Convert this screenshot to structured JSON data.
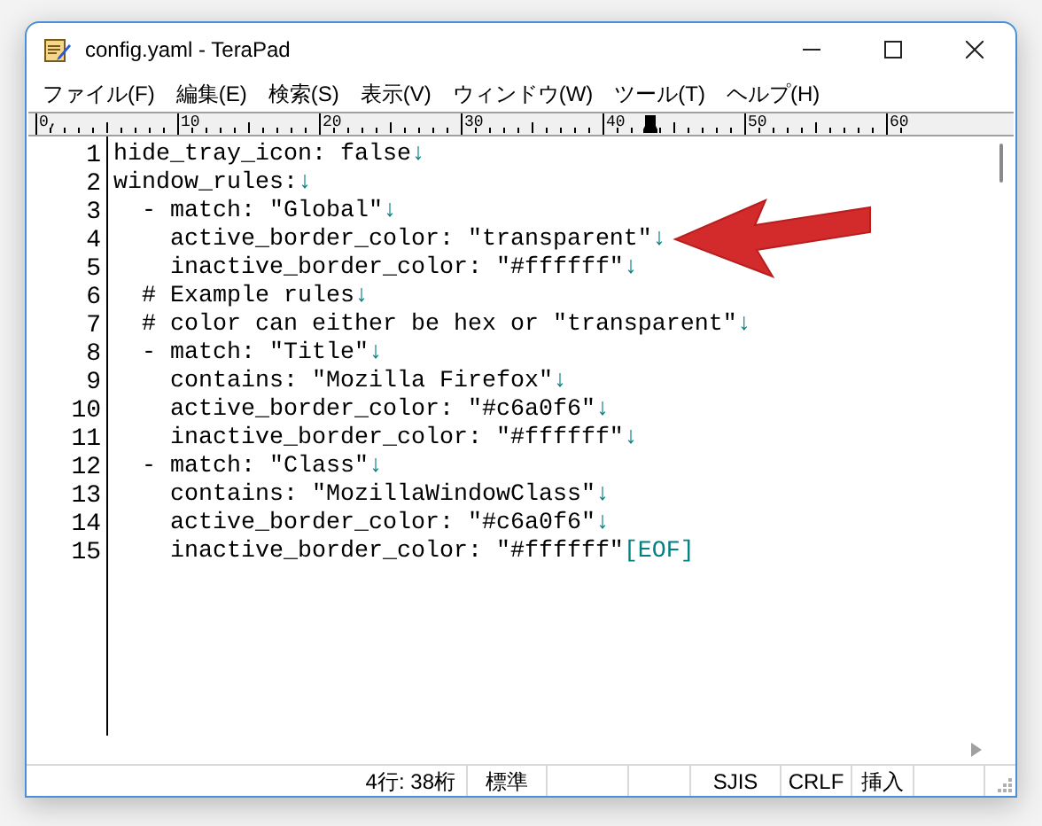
{
  "window": {
    "title": "config.yaml - TeraPad"
  },
  "menu": [
    "ファイル(F)",
    "編集(E)",
    "検索(S)",
    "表示(V)",
    "ウィンドウ(W)",
    "ツール(T)",
    "ヘルプ(H)"
  ],
  "ruler": {
    "labels": [
      "0,",
      "10",
      "20",
      "30",
      "40",
      "50",
      "60"
    ]
  },
  "lines": [
    {
      "number": "1",
      "text": "hide_tray_icon: false",
      "end": "↓"
    },
    {
      "number": "2",
      "text": "window_rules:",
      "end": "↓"
    },
    {
      "number": "3",
      "text": "  - match: \"Global\"",
      "end": "↓"
    },
    {
      "number": "4",
      "text": "    active_border_color: \"transparent\"",
      "end": "↓"
    },
    {
      "number": "5",
      "text": "    inactive_border_color: \"#ffffff\"",
      "end": "↓"
    },
    {
      "number": "6",
      "text": "  # Example rules",
      "end": "↓"
    },
    {
      "number": "7",
      "text": "  # color can either be hex or \"transparent\"",
      "end": "↓"
    },
    {
      "number": "8",
      "text": "  - match: \"Title\"",
      "end": "↓"
    },
    {
      "number": "9",
      "text": "    contains: \"Mozilla Firefox\"",
      "end": "↓"
    },
    {
      "number": "10",
      "text": "    active_border_color: \"#c6a0f6\"",
      "end": "↓"
    },
    {
      "number": "11",
      "text": "    inactive_border_color: \"#ffffff\"",
      "end": "↓"
    },
    {
      "number": "12",
      "text": "  - match: \"Class\"",
      "end": "↓"
    },
    {
      "number": "13",
      "text": "    contains: \"MozillaWindowClass\"",
      "end": "↓"
    },
    {
      "number": "14",
      "text": "    active_border_color: \"#c6a0f6\"",
      "end": "↓"
    },
    {
      "number": "15",
      "text": "    inactive_border_color: \"#ffffff\"",
      "end": "[EOF]"
    }
  ],
  "status_bar": [
    "4行: 38桁",
    "標準",
    "SJIS",
    "CRLF",
    "挿入"
  ]
}
